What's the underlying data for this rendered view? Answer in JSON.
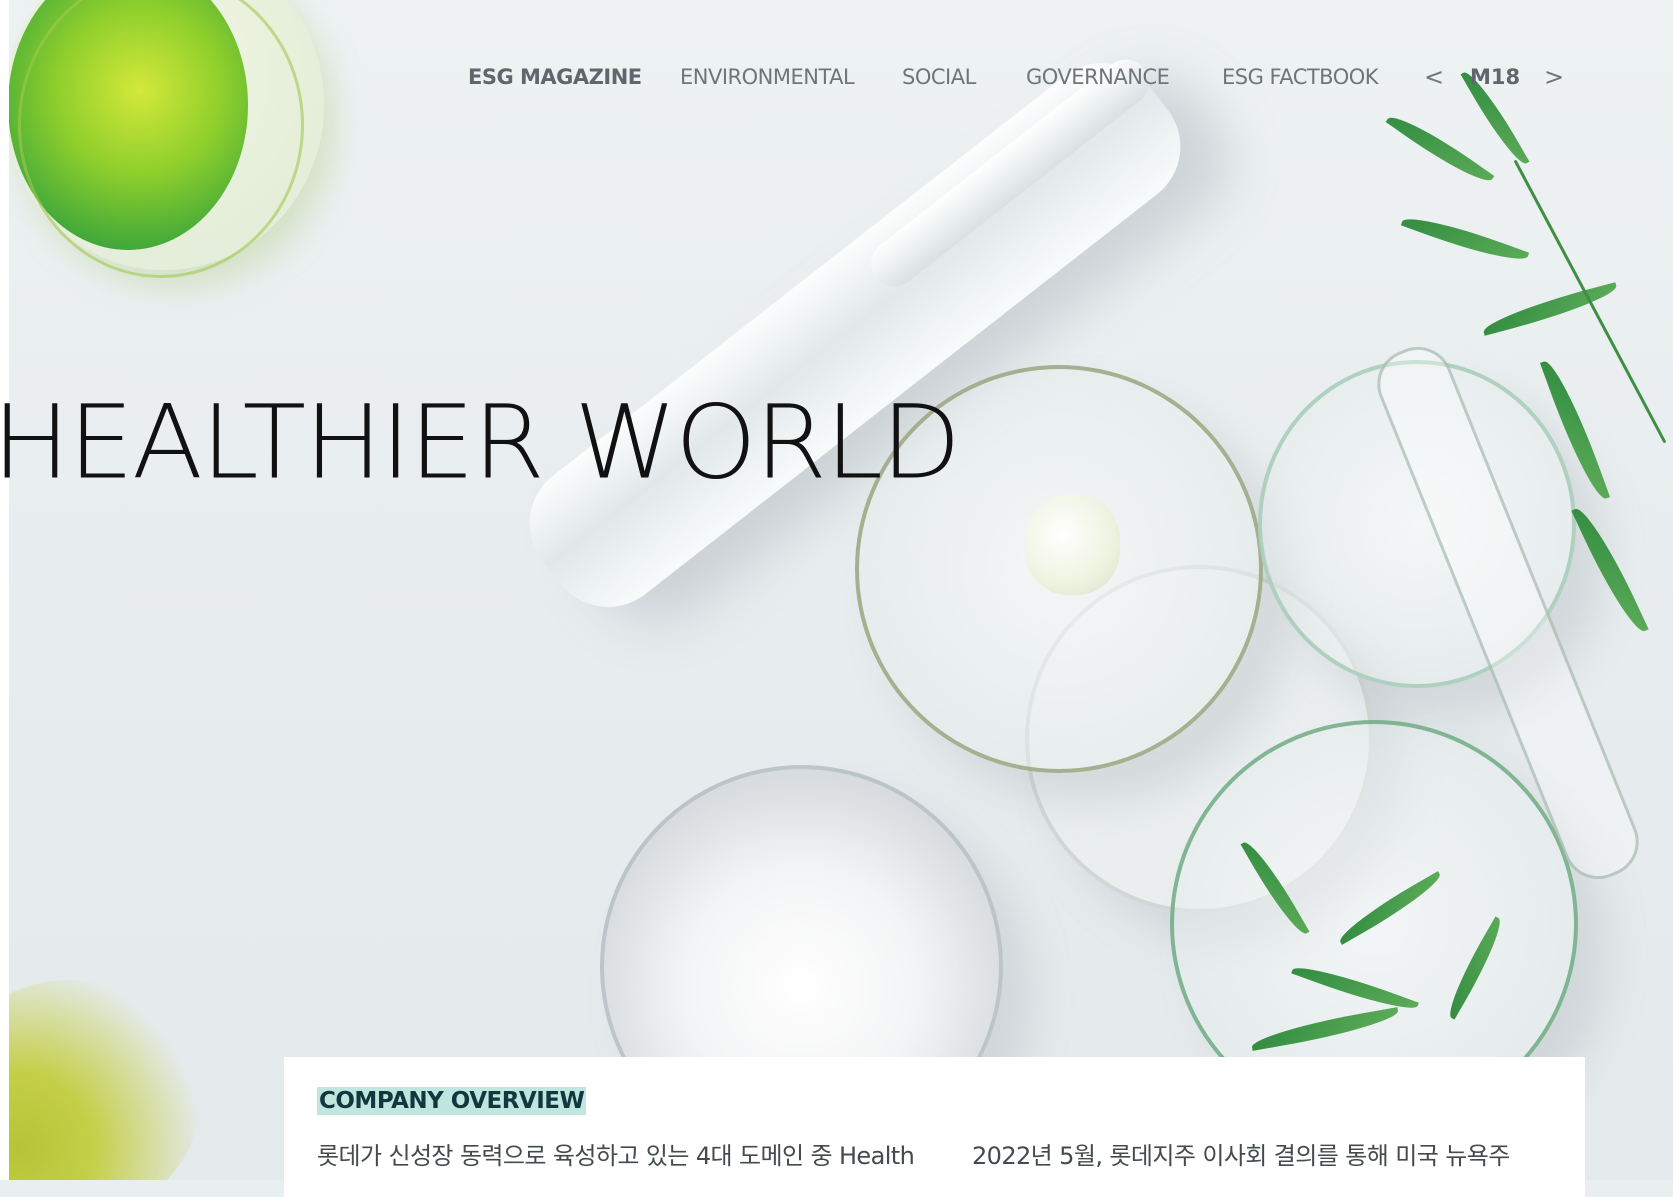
{
  "nav": {
    "items": [
      {
        "label": "ESG MAGAZINE",
        "active": true
      },
      {
        "label": "ENVIRONMENTAL",
        "active": false
      },
      {
        "label": "SOCIAL",
        "active": false
      },
      {
        "label": "GOVERNANCE",
        "active": false
      },
      {
        "label": "ESG FACTBOOK",
        "active": false
      }
    ],
    "prev_label": "<",
    "issue_label": "M18",
    "next_label": ">"
  },
  "hero": {
    "headline": "HEALTHIER WORLD"
  },
  "card": {
    "section_label": "COMPANY OVERVIEW",
    "paragraph_left": "롯데가 신성장 동력으로 육성하고 있는 4대 도메인 중 Health",
    "paragraph_right": "2022년 5월, 롯데지주 이사회 결의를 통해 미국 뉴욕주"
  },
  "colors": {
    "section_highlight": "#bfe7e0",
    "nav_text": "#6f767a",
    "headline_text": "#111111"
  }
}
